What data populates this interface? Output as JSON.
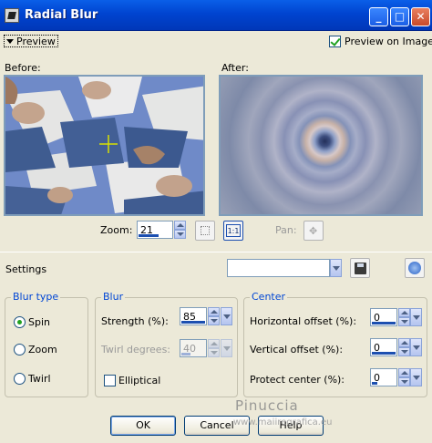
{
  "window": {
    "title": "Radial Blur",
    "title_buttons": {
      "minimize": "_",
      "maximize": "□",
      "close": "✕"
    }
  },
  "preview": {
    "toggle_label": "Preview",
    "preview_on_image_label": "Preview on Image",
    "preview_on_image_checked": true,
    "before_label": "Before:",
    "after_label": "After:"
  },
  "zoom": {
    "label": "Zoom:",
    "value": "21",
    "fit_button": "fit-icon",
    "actual_size_label": "1:1",
    "pan_label": "Pan:"
  },
  "settings": {
    "label": "Settings",
    "preset_value": "",
    "save_icon": "floppy-disk-icon",
    "reset_icon": "reset-arrow-icon"
  },
  "blur_type": {
    "title": "Blur type",
    "options": [
      "Spin",
      "Zoom",
      "Twirl"
    ],
    "selected": "Spin"
  },
  "blur": {
    "title": "Blur",
    "strength_label": "Strength (%):",
    "strength_value": "85",
    "twirl_label": "Twirl degrees:",
    "twirl_value": "40",
    "elliptical_label": "Elliptical",
    "elliptical_checked": false
  },
  "center": {
    "title": "Center",
    "horizontal_label": "Horizontal offset (%):",
    "horizontal_value": "0",
    "vertical_label": "Vertical offset (%):",
    "vertical_value": "0",
    "protect_label": "Protect center (%):",
    "protect_value": "0"
  },
  "buttons": {
    "ok": "OK",
    "cancel": "Cancel",
    "help": "Help"
  },
  "watermark": {
    "name": "Pinuccia",
    "url": "www.maiiregrafica.eu"
  },
  "colors": {
    "title_bar": "#0044d0",
    "dialog_bg": "#ece9d8",
    "group_title": "#0046d5",
    "check_mark": "#21a121"
  }
}
